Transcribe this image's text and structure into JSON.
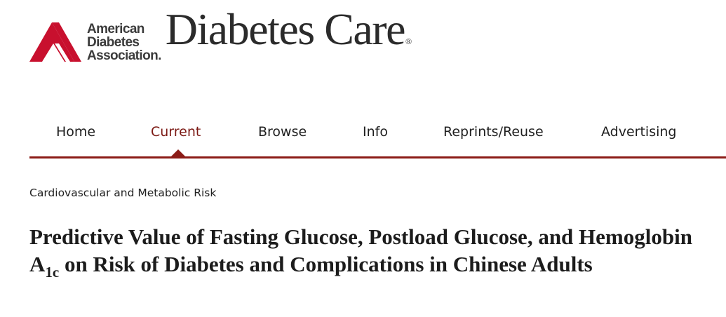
{
  "header": {
    "org_logo_lines": [
      "American",
      "Diabetes",
      "Association."
    ],
    "journal_title": "Diabetes Care",
    "journal_mark": "®",
    "brand_color": "#c8102e"
  },
  "nav": {
    "items": [
      {
        "label": "Home",
        "active": false
      },
      {
        "label": "Current",
        "active": true
      },
      {
        "label": "Browse",
        "active": false
      },
      {
        "label": "Info",
        "active": false
      },
      {
        "label": "Reprints/Reuse",
        "active": false
      },
      {
        "label": "Advertising",
        "active": false
      }
    ],
    "accent_color": "#8b1c17"
  },
  "article": {
    "category": "Cardiovascular and Metabolic Risk",
    "title_part1": "Predictive Value of Fasting Glucose, Postload Glucose, and Hemoglobin A",
    "title_subscript": "1c",
    "title_part2": " on Risk of Diabetes and Complications in Chinese Adults"
  }
}
